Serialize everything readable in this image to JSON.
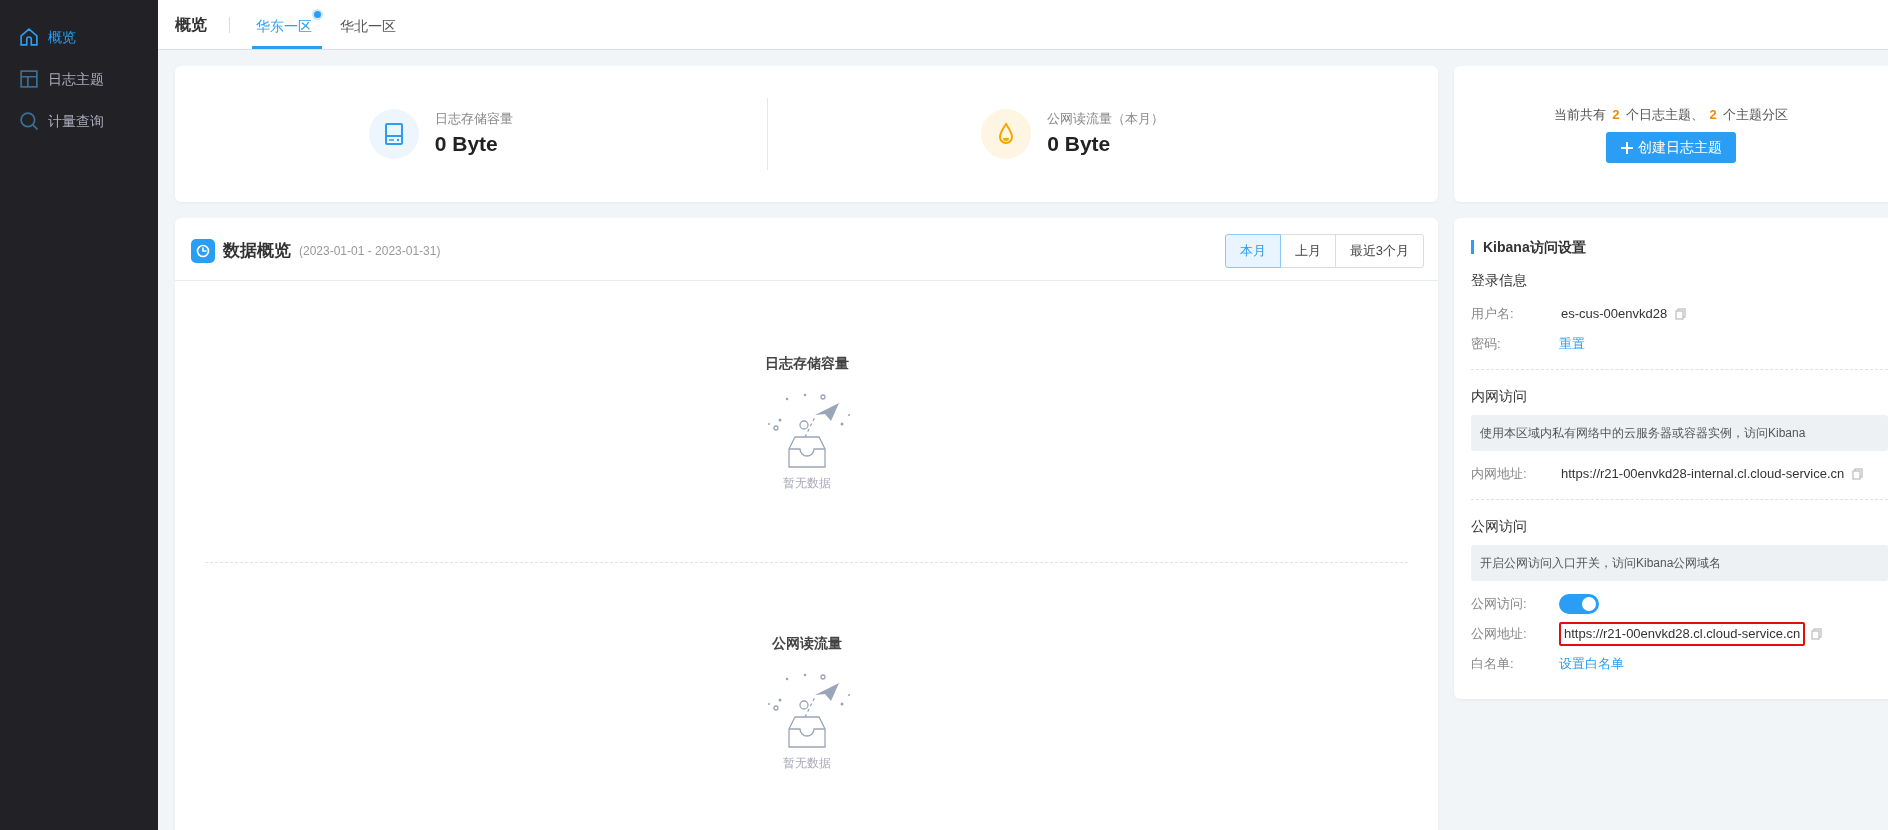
{
  "sidebar": {
    "items": [
      {
        "label": "概览",
        "selected": true
      },
      {
        "label": "日志主题",
        "selected": false
      },
      {
        "label": "计量查询",
        "selected": false
      }
    ]
  },
  "header": {
    "title": "概览",
    "tabs": [
      {
        "label": "华东一区",
        "selected": true,
        "dot": true
      },
      {
        "label": "华北一区",
        "selected": false,
        "dot": false
      }
    ]
  },
  "stats": [
    {
      "label": "日志存储容量",
      "value": "0 Byte"
    },
    {
      "label": "公网读流量（本月）",
      "value": "0 Byte"
    }
  ],
  "summary": {
    "parts": [
      {
        "kind": "text",
        "text": "当前共有"
      },
      {
        "kind": "count",
        "text": "2"
      },
      {
        "kind": "text",
        "text": "个日志主题、"
      },
      {
        "kind": "count",
        "text": "2"
      },
      {
        "kind": "text",
        "text": "个主题分区"
      }
    ],
    "button": "创建日志主题"
  },
  "overview": {
    "title": "数据概览",
    "range": "(2023-01-01 - 2023-01-31)",
    "periods": [
      {
        "label": "本月",
        "selected": true
      },
      {
        "label": "上月",
        "selected": false
      },
      {
        "label": "最近3个月",
        "selected": false
      }
    ],
    "charts": [
      {
        "title": "日志存储容量",
        "empty_text": "暂无数据"
      },
      {
        "title": "公网读流量",
        "empty_text": "暂无数据"
      }
    ]
  },
  "kibana": {
    "title": "Kibana访问设置",
    "sections": [
      {
        "title": "登录信息",
        "rows": [
          {
            "kind": "text",
            "label": "用户名:",
            "value": "es-cus-00envkd28",
            "copyable": true,
            "highlighted": false
          },
          {
            "kind": "link",
            "label": "密码:",
            "value": "重置",
            "copyable": false,
            "highlighted": false
          }
        ]
      },
      {
        "title": "内网访问",
        "note": "使用本区域内私有网络中的云服务器或容器实例，访问Kibana",
        "rows": [
          {
            "kind": "text",
            "label": "内网地址:",
            "value": "https://r21-00envkd28-internal.cl.cloud-service.cn",
            "copyable": true,
            "highlighted": false
          }
        ]
      },
      {
        "title": "公网访问",
        "note": "开启公网访问入口开关，访问Kibana公网域名",
        "rows": [
          {
            "kind": "toggle",
            "label": "公网访问:",
            "on": true
          },
          {
            "kind": "text",
            "label": "公网地址:",
            "value": "https://r21-00envkd28.cl.cloud-service.cn",
            "copyable": true,
            "highlighted": true
          },
          {
            "kind": "link",
            "label": "白名单:",
            "value": "设置白名单",
            "copyable": false,
            "highlighted": false
          }
        ]
      }
    ]
  }
}
